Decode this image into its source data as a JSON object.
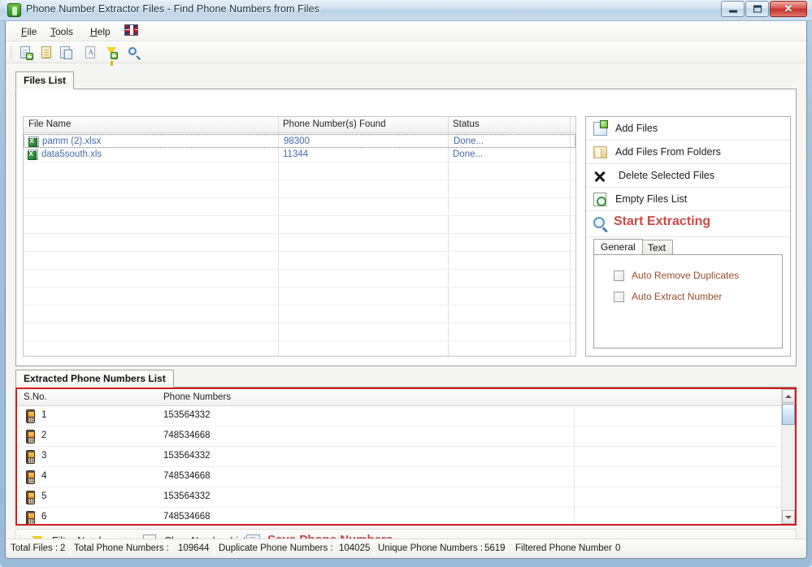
{
  "window": {
    "title": "Phone Number Extractor Files - Find Phone Numbers from Files",
    "app_icon": "phone-app-icon",
    "controls": {
      "minimize": "–",
      "maximize": "❑",
      "close": "✕"
    },
    "accent_red": "#cf4747",
    "highlight_border": "#d41a1a"
  },
  "menubar": {
    "items": [
      {
        "label": "File",
        "mnemonic": "F"
      },
      {
        "label": "Tools",
        "mnemonic": "T"
      },
      {
        "label": "Help",
        "mnemonic": "H"
      }
    ],
    "flag_icon": "uk-flag-icon"
  },
  "toolbar": {
    "icons": [
      {
        "name": "add-files-icon"
      },
      {
        "name": "add-files-from-folders-icon"
      },
      {
        "name": "copy-files-icon"
      },
      {
        "name": "text-extract-icon"
      },
      {
        "name": "filter-numbers-icon"
      },
      {
        "name": "search-icon"
      }
    ]
  },
  "files_tab": {
    "label": "Files List"
  },
  "files_grid": {
    "columns": [
      "File Name",
      "Phone Number(s) Found",
      "Status"
    ],
    "rows": [
      {
        "file_name": "pamm (2).xlsx",
        "found": "98300",
        "status": "Done..."
      },
      {
        "file_name": "data5south.xls",
        "found": "11344",
        "status": "Done..."
      }
    ]
  },
  "action_panel": {
    "items": [
      {
        "label": "Add Files",
        "icon": "add-files-icon"
      },
      {
        "label": "Add Files From Folders",
        "icon": "folder-icon"
      },
      {
        "label": "Delete Selected Files",
        "icon": "x-icon"
      },
      {
        "label": "Empty Files List",
        "icon": "empty-list-icon"
      },
      {
        "label": "Start Extracting",
        "icon": "magnifier-icon"
      }
    ]
  },
  "options": {
    "tabs": [
      {
        "label": "General",
        "active": true
      },
      {
        "label": "Text",
        "active": false
      }
    ],
    "checkboxes": [
      {
        "label": "Auto Remove Duplicates",
        "checked": false
      },
      {
        "label": "Auto Extract Number",
        "checked": false
      }
    ]
  },
  "extracted_tab": {
    "label": "Extracted Phone Numbers List"
  },
  "extracted_grid": {
    "columns": [
      "S.No.",
      "Phone Numbers"
    ],
    "rows": [
      {
        "sno": "1",
        "number": "153564332"
      },
      {
        "sno": "2",
        "number": "748534668"
      },
      {
        "sno": "3",
        "number": "153564332"
      },
      {
        "sno": "4",
        "number": "748534668"
      },
      {
        "sno": "5",
        "number": "153564332"
      },
      {
        "sno": "6",
        "number": "748534668"
      }
    ]
  },
  "bottom_bar": {
    "items": [
      {
        "label": "Filter Numbers",
        "icon": "filter-icon"
      },
      {
        "label": "Clear Number List",
        "icon": "clear-list-icon"
      },
      {
        "label": "Save Phone Numbers",
        "icon": "save-icon"
      }
    ]
  },
  "statusbar": {
    "total_files_label": "Total Files :",
    "total_files_value": "2",
    "total_numbers_label": "Total Phone Numbers :",
    "total_numbers_value": "109644",
    "duplicate_label": "Duplicate Phone Numbers :",
    "duplicate_value": "104025",
    "unique_label": "Unique Phone Numbers :",
    "unique_value": "5619",
    "filtered_label": "Filtered Phone Number",
    "filtered_value": "0"
  }
}
